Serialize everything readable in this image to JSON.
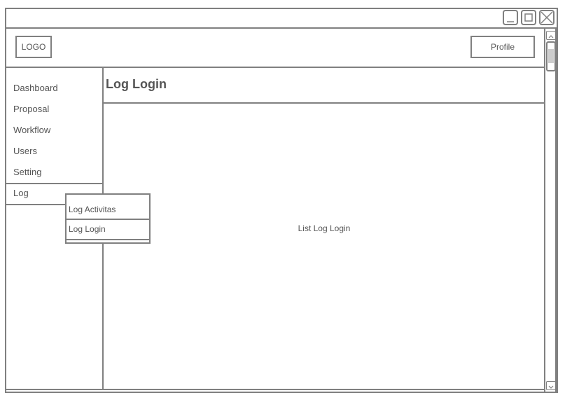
{
  "header": {
    "logo_label": "LOGO",
    "profile_label": "Profile"
  },
  "window_controls": [
    "minimize-icon",
    "maximize-icon",
    "close-icon"
  ],
  "sidebar": {
    "items": [
      {
        "label": "Dashboard"
      },
      {
        "label": "Proposal"
      },
      {
        "label": "Workflow"
      },
      {
        "label": "Users"
      },
      {
        "label": "Setting"
      },
      {
        "label": "Log"
      }
    ]
  },
  "dropdown": {
    "items": [
      {
        "label": "Log Activitas"
      },
      {
        "label": "Log Login"
      }
    ]
  },
  "main": {
    "title": "Log Login",
    "content_label": "List Log Login"
  },
  "colors": {
    "stroke": "#808080",
    "text": "#555555",
    "background": "#ffffff"
  }
}
